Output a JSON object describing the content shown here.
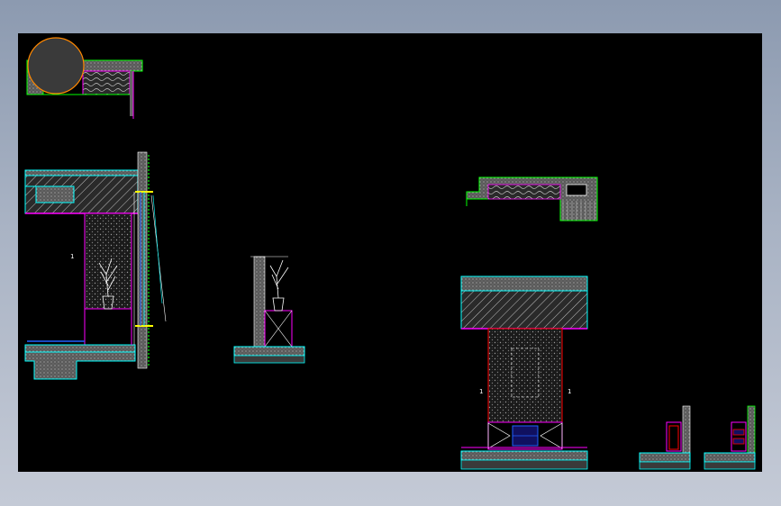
{
  "window": {
    "background_top": "#8c9ab0",
    "background_bottom": "#c4cad6",
    "canvas_color": "#000000"
  },
  "drawing": {
    "labels": {
      "left_section_mark": "1",
      "right_section_mark_left": "1",
      "right_section_mark_right": "1"
    },
    "colors": {
      "wall_hatch": "#9a9a9a",
      "cyan_line": "#00ffff",
      "magenta_line": "#ff00ff",
      "green_line": "#00ff00",
      "yellow_line": "#ffff00",
      "red_line": "#ff0000",
      "blue_line": "#2060ff",
      "white_line": "#ffffff",
      "orange_line": "#ff8800"
    }
  }
}
